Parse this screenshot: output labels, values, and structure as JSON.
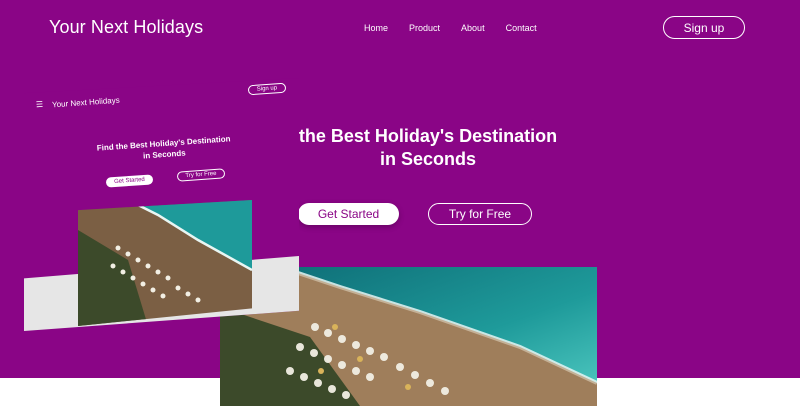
{
  "header": {
    "brand": "Your Next Holidays",
    "nav": [
      "Home",
      "Product",
      "About",
      "Contact"
    ],
    "signup_label": "Sign up"
  },
  "hero": {
    "headline_line1": "the Best Holiday's Destination",
    "headline_line2": "in Seconds",
    "primary_cta": "Get Started",
    "secondary_cta": "Try for Free"
  },
  "mockup": {
    "menu_icon": "☰",
    "brand": "Your Next Holidays",
    "signup_label": "Sign up",
    "headline": "Find the Best Holiday's Destination in Seconds",
    "primary_cta": "Get Started",
    "secondary_cta": "Try for Free"
  },
  "colors": {
    "brand_purple": "#8a0586",
    "white": "#ffffff",
    "sea": "#1f8a8a",
    "sand": "#9a7a5a"
  }
}
